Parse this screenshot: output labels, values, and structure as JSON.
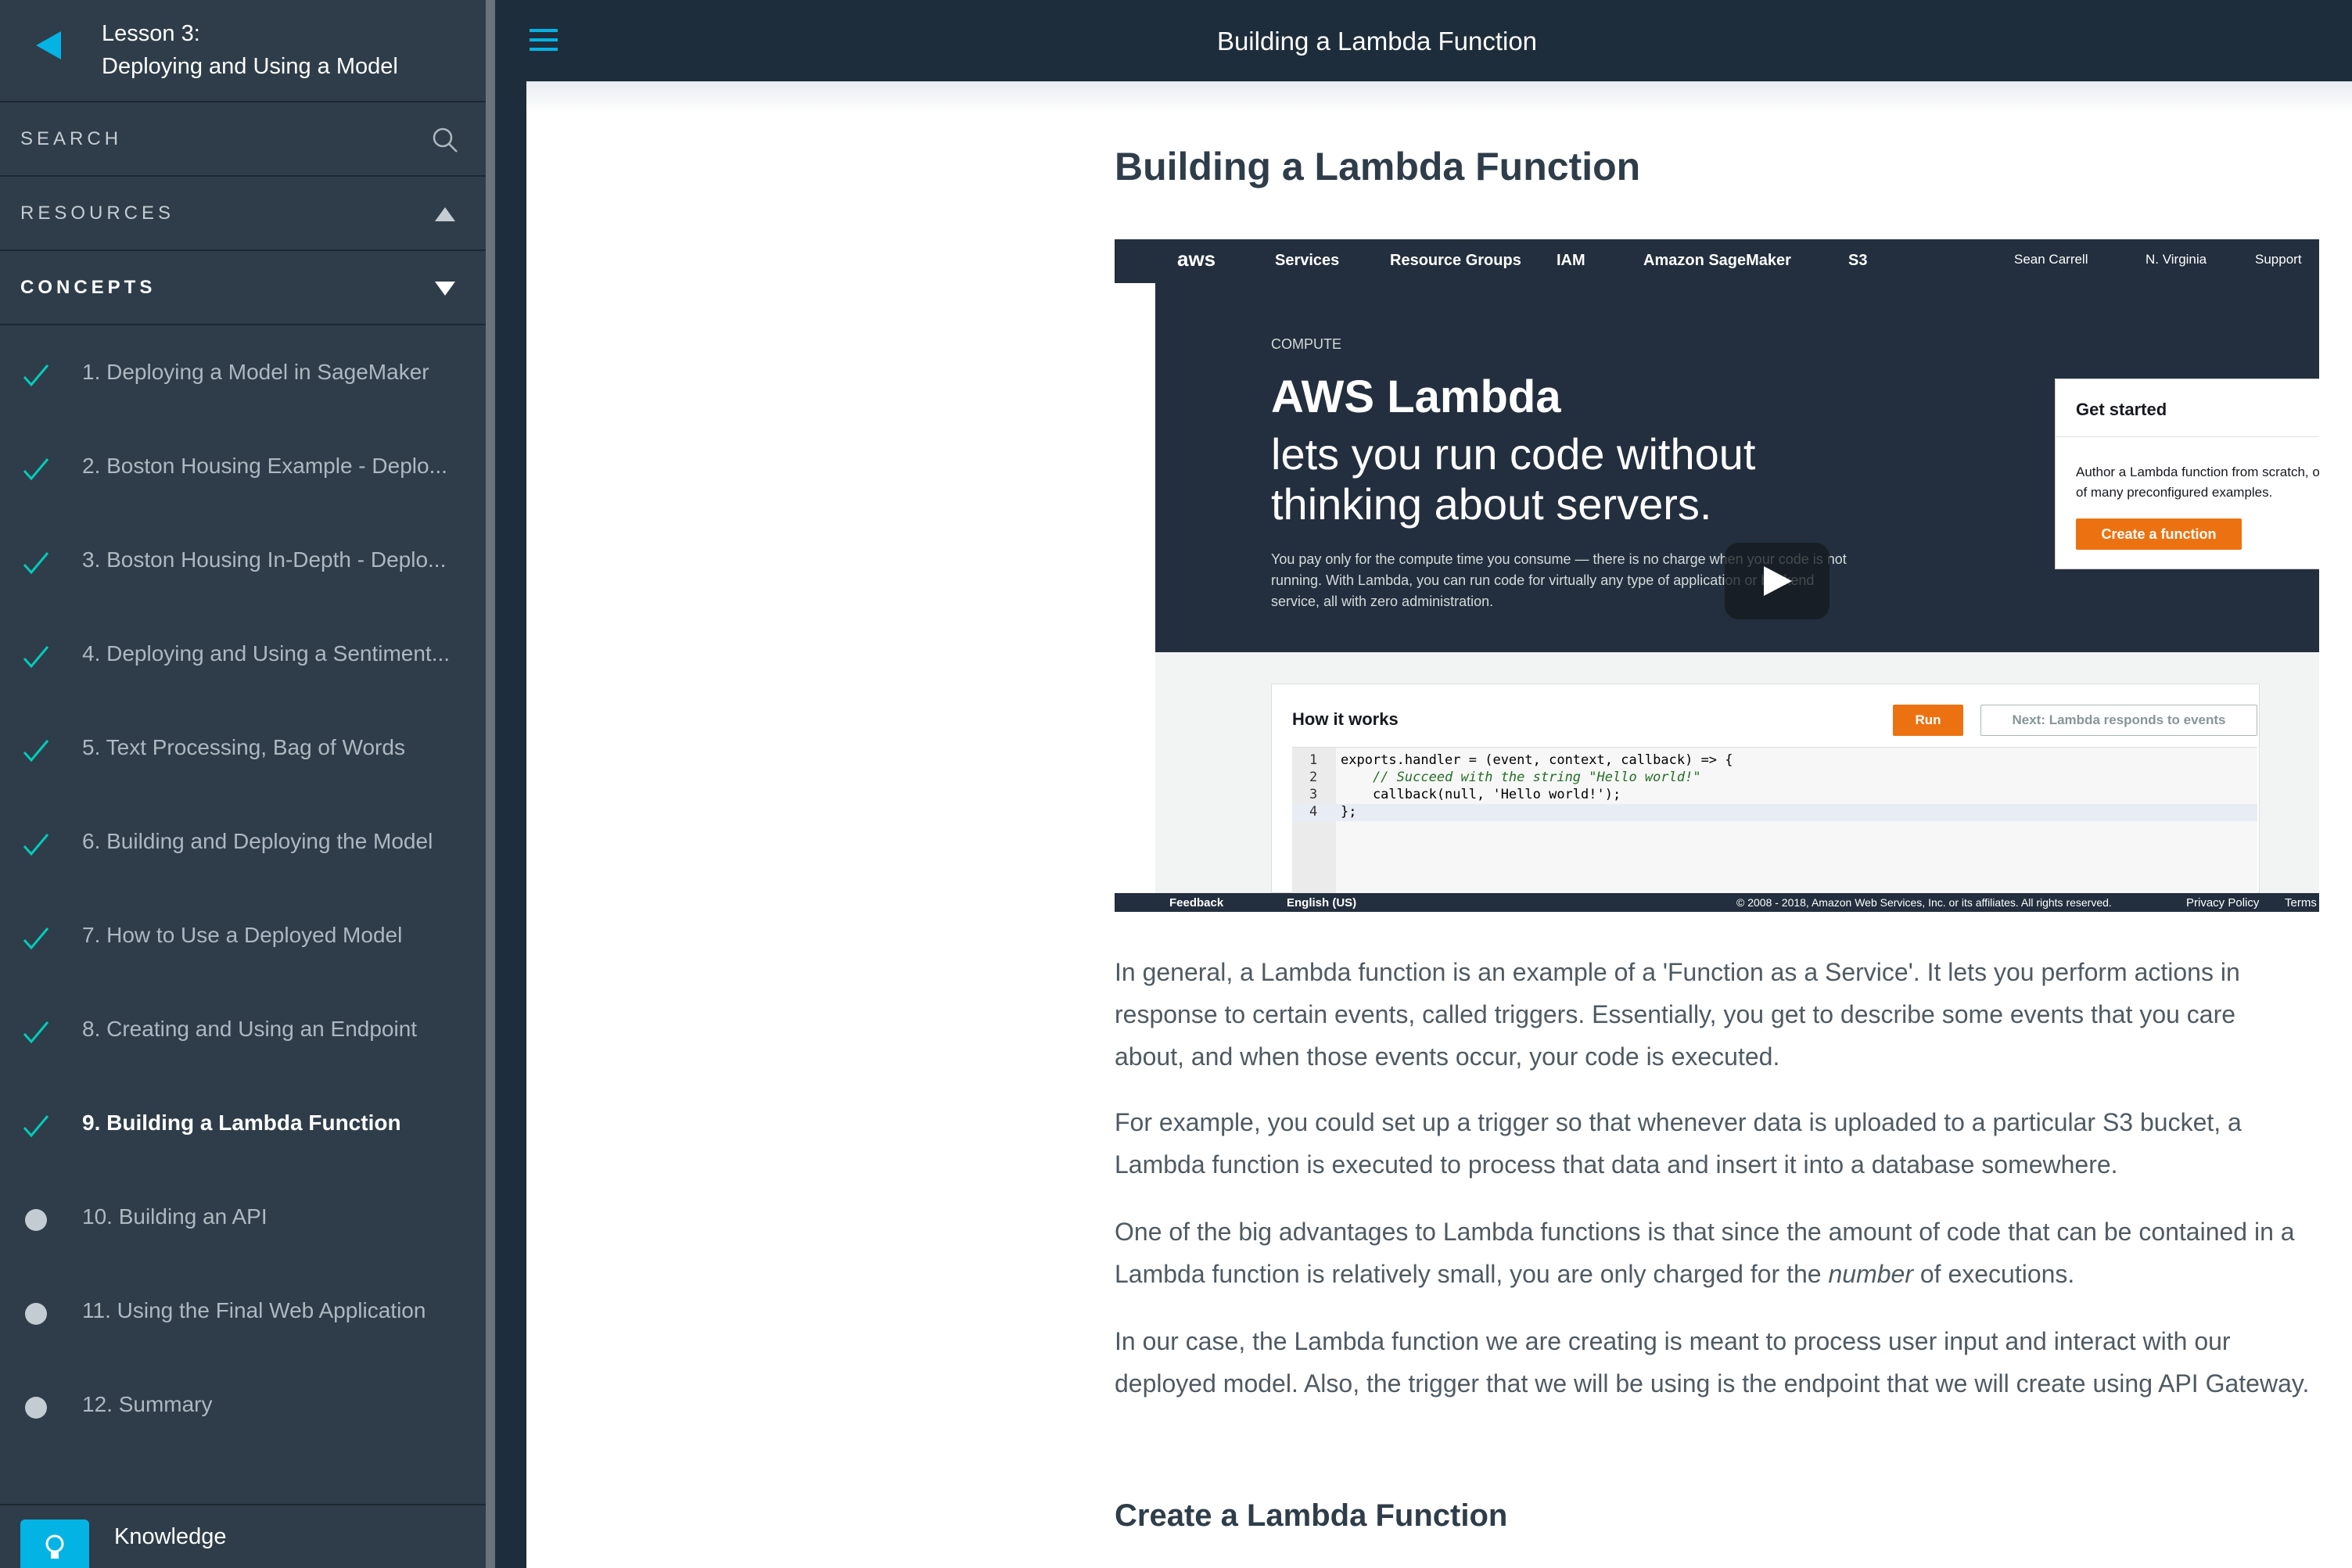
{
  "colors": {
    "sidebar_bg": "#2e3d49",
    "accent": "#02b3e4",
    "check": "#02ccba",
    "aws_orange": "#ec7211"
  },
  "lesson": {
    "label": "Lesson 3:",
    "name": "Deploying and Using a Model"
  },
  "sidebar": {
    "search_label": "SEARCH",
    "resources_label": "RESOURCES",
    "concepts_label": "CONCEPTS",
    "concepts": [
      {
        "title": "1. Deploying a Model in SageMaker",
        "status": "complete"
      },
      {
        "title": "2. Boston Housing Example - Deplo...",
        "status": "complete"
      },
      {
        "title": "3. Boston Housing In-Depth - Deplo...",
        "status": "complete"
      },
      {
        "title": "4. Deploying and Using a Sentiment...",
        "status": "complete"
      },
      {
        "title": "5. Text Processing, Bag of Words",
        "status": "complete"
      },
      {
        "title": "6. Building and Deploying the Model",
        "status": "complete"
      },
      {
        "title": "7. How to Use a Deployed Model",
        "status": "complete"
      },
      {
        "title": "8. Creating and Using an Endpoint",
        "status": "complete"
      },
      {
        "title": "9. Building a Lambda Function",
        "status": "complete"
      },
      {
        "title": "10. Building an API",
        "status": "incomplete"
      },
      {
        "title": "11. Using the Final Web Application",
        "status": "incomplete"
      },
      {
        "title": "12. Summary",
        "status": "incomplete"
      }
    ],
    "knowledge_label": "Knowledge"
  },
  "header": {
    "title": "Building a Lambda Function"
  },
  "article": {
    "title": "Building a Lambda Function",
    "video": {
      "nav": {
        "logo": "aws",
        "services": "Services",
        "resource_groups": "Resource Groups",
        "iam": "IAM",
        "sagemaker": "Amazon SageMaker",
        "s3": "S3",
        "user": "Sean Carrell",
        "region": "N. Virginia",
        "support": "Support"
      },
      "eyebrow": "COMPUTE",
      "hero_title": "AWS Lambda",
      "hero_sub1": "lets you run code without",
      "hero_sub2": "thinking about servers.",
      "hero_body": "You pay only for the compute time you consume — there is no charge when your code is not running. With Lambda, you can run code for virtually any type of application or backend service, all with zero administration.",
      "get_started_title": "Get started",
      "get_started_body": "Author a Lambda function from scratch, or choose from one of many preconfigured examples.",
      "create_button": "Create a function",
      "how_title": "How it works",
      "run_button": "Run",
      "next_button": "Next: Lambda responds to events",
      "code": [
        {
          "ln": "1",
          "text": "exports.handler = (event, context, callback) => {"
        },
        {
          "ln": "2",
          "text": "    // Succeed with the string \"Hello world!\""
        },
        {
          "ln": "3",
          "text": "    callback(null, 'Hello world!');"
        },
        {
          "ln": "4",
          "text": "};"
        }
      ],
      "footer_left": "Feedback",
      "footer_lang": "English (US)",
      "footer_copyright": "© 2008 - 2018, Amazon Web Services, Inc. or its affiliates. All rights reserved.",
      "footer_privacy": "Privacy Policy",
      "footer_terms": "Terms"
    },
    "para1": "In general, a Lambda function is an example of a 'Function as a Service'. It lets you perform actions in response to certain events, called triggers. Essentially, you get to describe some events that you care about, and when those events occur, your code is executed.",
    "para2": "For example, you could set up a trigger so that whenever data is uploaded to a particular S3 bucket, a Lambda function is executed to process that data and insert it into a database somewhere.",
    "para3_before": "One of the big advantages to Lambda functions is that since the amount of code that can be contained in a Lambda function is relatively small, you are only charged for the ",
    "para3_em": "number",
    "para3_after": " of executions.",
    "para4": "In our case, the Lambda function we are creating is meant to process user input and interact with our deployed model. Also, the trigger that we will be using is the endpoint that we will create using API Gateway.",
    "section_heading": "Create a Lambda Function"
  }
}
